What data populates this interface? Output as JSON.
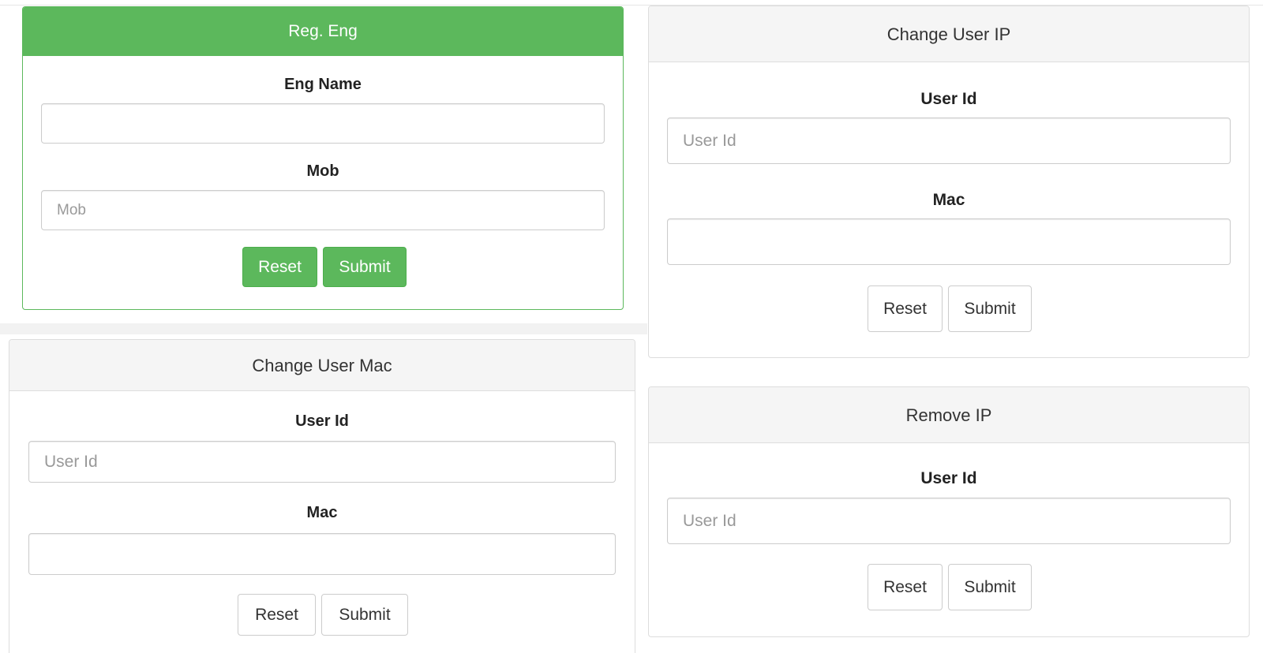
{
  "reg_eng": {
    "title": "Reg. Eng",
    "eng_name_label": "Eng Name",
    "eng_name_value": "",
    "mob_label": "Mob",
    "mob_placeholder": "Mob",
    "reset_label": "Reset",
    "submit_label": "Submit"
  },
  "change_user_ip": {
    "title": "Change User IP",
    "user_id_label": "User Id",
    "user_id_placeholder": "User Id",
    "mac_label": "Mac",
    "mac_value": "",
    "reset_label": "Reset",
    "submit_label": "Submit"
  },
  "change_user_mac": {
    "title": "Change User Mac",
    "user_id_label": "User Id",
    "user_id_placeholder": "User Id",
    "mac_label": "Mac",
    "mac_value": "",
    "reset_label": "Reset",
    "submit_label": "Submit"
  },
  "remove_ip": {
    "title": "Remove IP",
    "user_id_label": "User Id",
    "user_id_placeholder": "User Id",
    "reset_label": "Reset",
    "submit_label": "Submit"
  },
  "colors": {
    "success": "#5cb85c",
    "panel_heading_bg": "#f5f5f5",
    "border": "#dddddd"
  }
}
